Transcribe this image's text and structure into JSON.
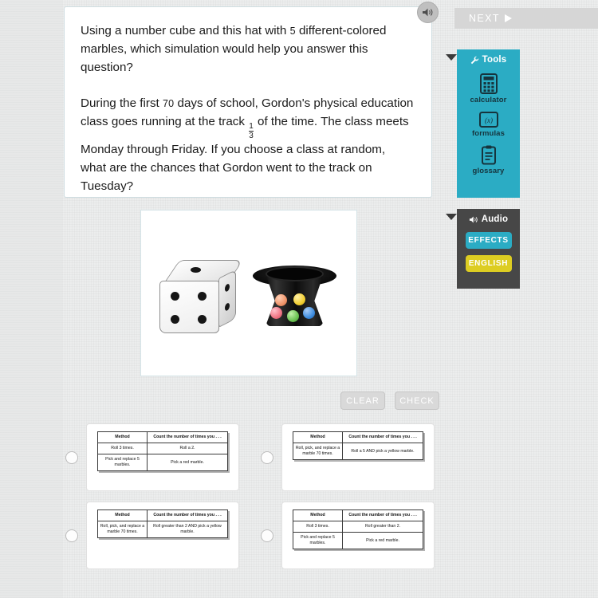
{
  "question": {
    "paragraph1": "Using a number cube and this hat with 5 different-colored marbles, which simulation would help you answer this question?",
    "paragraph1_pre": "Using a number cube and this hat with ",
    "paragraph1_num": "5",
    "paragraph1_post": " different-colored marbles, which simulation would help you answer this question?",
    "paragraph2_pre": "During the first ",
    "paragraph2_num": "70",
    "paragraph2_mid": " days of school, Gordon's physical education class goes running at the track ",
    "fraction_numerator": "1",
    "fraction_denominator": "3",
    "paragraph2_post": " of the time. The class meets Monday through Friday. If you choose a class at random, what are the chances that Gordon went to the track on Tuesday?"
  },
  "speaker_button": {
    "icon": "speaker-icon"
  },
  "rail": {
    "next_label": "NEXT",
    "tools": {
      "title": "Tools",
      "items": [
        {
          "label": "calculator",
          "icon": "calculator-icon"
        },
        {
          "label": "formulas",
          "icon": "formulas-icon"
        },
        {
          "label": "glossary",
          "icon": "glossary-icon"
        }
      ]
    },
    "audio": {
      "title": "Audio",
      "buttons": [
        {
          "label": "EFFECTS",
          "color": "#2bacc4"
        },
        {
          "label": "ENGLISH",
          "color": "#ddcd22"
        }
      ]
    }
  },
  "stimulus": {
    "alt": "A white number cube (die) and a black top hat containing five different-colored marbles",
    "die_pips_top": 1,
    "die_pips_front": 4,
    "marbles": [
      {
        "name": "orange-marble",
        "color": "#f0956b"
      },
      {
        "name": "yellow-marble",
        "color": "#f2cf32"
      },
      {
        "name": "pink-marble",
        "color": "#ef7584"
      },
      {
        "name": "green-marble",
        "color": "#6cc253"
      },
      {
        "name": "blue-marble",
        "color": "#3f8ee0"
      }
    ]
  },
  "actions": {
    "clear_label": "CLEAR",
    "check_label": "CHECK"
  },
  "options": [
    {
      "id": "option-a",
      "selected": false,
      "table": {
        "headers": [
          "Method",
          "Count the number of times you . . ."
        ],
        "rows": [
          [
            "Roll 3 times.",
            "Roll a 2."
          ],
          [
            "Pick and replace 5 marbles.",
            "Pick a red marble."
          ]
        ]
      }
    },
    {
      "id": "option-b",
      "selected": false,
      "table": {
        "headers": [
          "Method",
          "Count the number of times you . . ."
        ],
        "rows": [
          [
            "Roll, pick, and replace a marble 70 times.",
            "Roll a 5 AND pick a yellow marble."
          ]
        ]
      }
    },
    {
      "id": "option-c",
      "selected": false,
      "table": {
        "headers": [
          "Method",
          "Count the number of times you . . ."
        ],
        "rows": [
          [
            "Roll, pick, and replace a marble 70 times.",
            "Roll greater than 2 AND pick a yellow marble."
          ]
        ]
      }
    },
    {
      "id": "option-d",
      "selected": false,
      "table": {
        "headers": [
          "Method",
          "Count the number of times you . . ."
        ],
        "rows": [
          [
            "Roll 3 times.",
            "Roll greater than 2."
          ],
          [
            "Pick and replace 5 marbles.",
            "Pick a red marble."
          ]
        ]
      }
    }
  ],
  "colors": {
    "tools_panel": "#2bacc4",
    "audio_panel": "#474747",
    "page_background": "#eceded"
  }
}
